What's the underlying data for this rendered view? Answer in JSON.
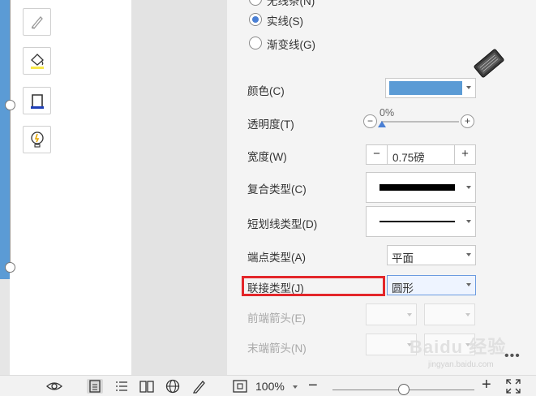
{
  "panel": {
    "radio_options": [
      {
        "label": "无线条(N)",
        "checked": false
      },
      {
        "label": "实线(S)",
        "checked": true
      },
      {
        "label": "渐变线(G)",
        "checked": false
      }
    ],
    "color": {
      "label": "颜色(C)",
      "value": "#5b9bd5"
    },
    "transparency": {
      "label": "透明度(T)",
      "value": "0%",
      "minus": "−",
      "plus": "+"
    },
    "width": {
      "label": "宽度(W)",
      "value": "0.75磅",
      "minus": "−",
      "plus": "+"
    },
    "compound_type": {
      "label": "复合类型(C)"
    },
    "dash_type": {
      "label": "短划线类型(D)"
    },
    "cap_type": {
      "label": "端点类型(A)",
      "value": "平面"
    },
    "join_type": {
      "label": "联接类型(J)",
      "value": "圆形"
    },
    "begin_arrow": {
      "label": "前端箭头(E)"
    },
    "end_arrow": {
      "label": "末端箭头(N)"
    }
  },
  "watermark": {
    "text": "Baidu 经验",
    "sub": "jingyan.baidu.com"
  },
  "more": "•••",
  "statusbar": {
    "zoom": "100%",
    "zoom_minus": "−",
    "zoom_plus": "+",
    "zoom_level": 0.5
  }
}
